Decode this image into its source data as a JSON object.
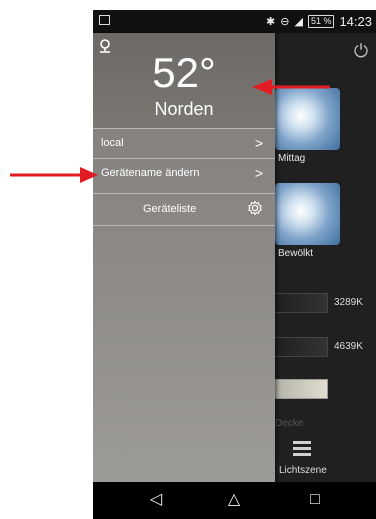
{
  "status_bar": {
    "battery": "51 %",
    "time": "14:23",
    "icons": [
      "image-icon",
      "bluetooth-icon",
      "dnd-icon",
      "signal-icon",
      "battery-icon"
    ]
  },
  "drawer": {
    "temperature": "52°",
    "direction": "Norden",
    "rows": [
      {
        "label": "local"
      },
      {
        "label": "Gerätename ändern"
      }
    ],
    "device_list_label": "Geräteliste"
  },
  "background": {
    "tiles": [
      {
        "label": "Mittag"
      },
      {
        "label": "Bewölkt"
      }
    ],
    "sliders": [
      {
        "value": "3289K"
      },
      {
        "value": "4639K"
      }
    ],
    "faint_label": "Decke",
    "scene_label": "Lichtszene"
  },
  "colors": {
    "arrow": "#e31b23",
    "drawer": "#8c8987",
    "app_bg": "#202020"
  }
}
